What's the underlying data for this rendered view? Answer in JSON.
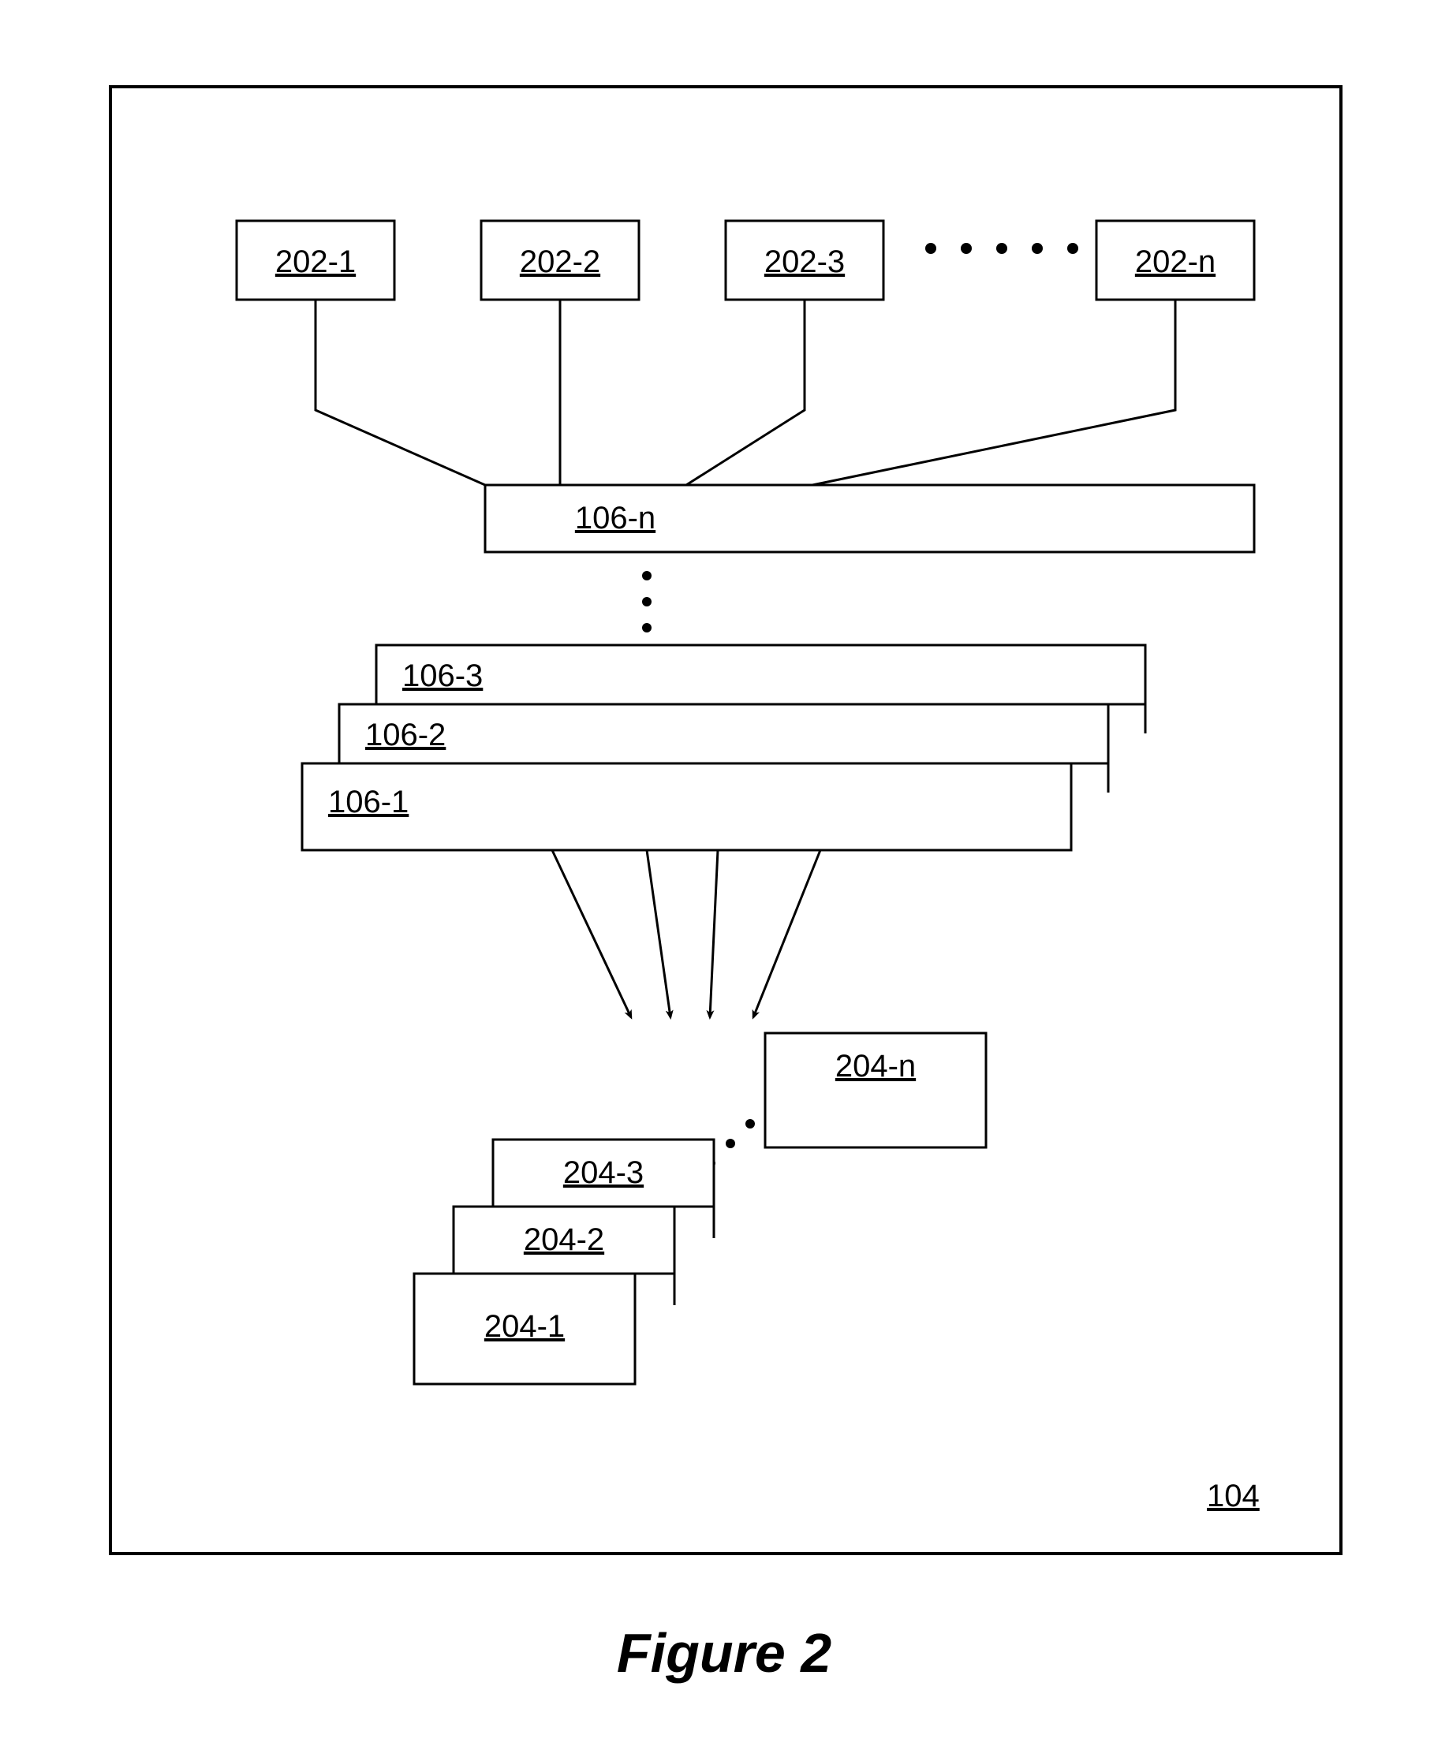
{
  "topRow": {
    "b1": "202-1",
    "b2": "202-2",
    "b3": "202-3",
    "bn": "202-n"
  },
  "layers": {
    "ln": "106-n",
    "l3": "106-3",
    "l2": "106-2",
    "l1": "106-1"
  },
  "outputs": {
    "o1": "204-1",
    "o2": "204-2",
    "o3": "204-3",
    "on": "204-n"
  },
  "frameId": "104",
  "caption": "Figure 2"
}
